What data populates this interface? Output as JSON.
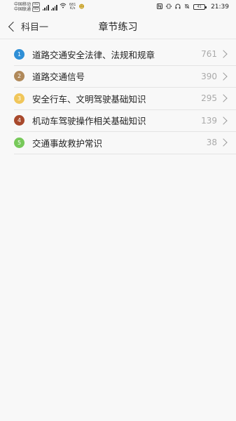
{
  "status_bar": {
    "carrier1": "中国移动",
    "carrier2": "中国联通",
    "hd1": "HD",
    "hd2": "HD",
    "net_speed_value": "681",
    "net_speed_unit": "K/s",
    "battery": "41",
    "time": "21:39"
  },
  "nav": {
    "back_label": "科目一",
    "title": "章节练习"
  },
  "chapters": [
    {
      "num": "1",
      "title": "道路交通安全法律、法规和规章",
      "count": "761",
      "color": "#2f8fd6"
    },
    {
      "num": "2",
      "title": "道路交通信号",
      "count": "390",
      "color": "#b0895a"
    },
    {
      "num": "3",
      "title": "安全行车、文明驾驶基础知识",
      "count": "295",
      "color": "#f0c65a"
    },
    {
      "num": "4",
      "title": "机动车驾驶操作相关基础知识",
      "count": "139",
      "color": "#a8492c"
    },
    {
      "num": "5",
      "title": "交通事故救护常识",
      "count": "38",
      "color": "#77c95a"
    }
  ]
}
